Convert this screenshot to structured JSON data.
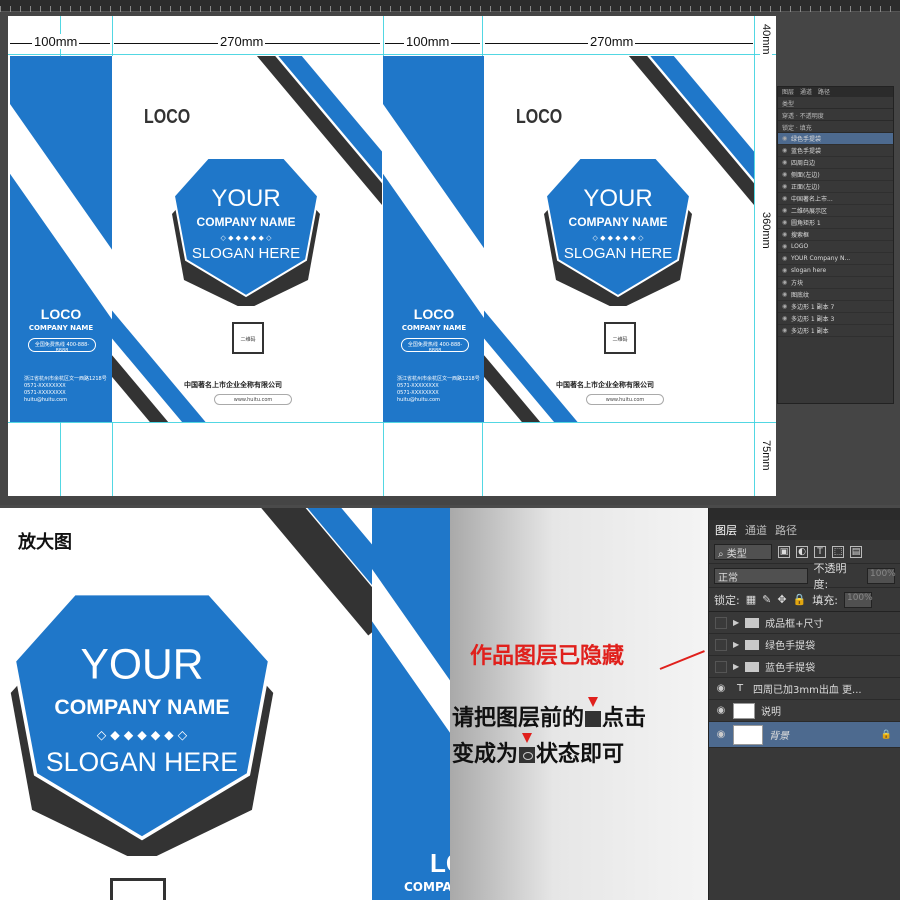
{
  "canvas": {
    "dimensions": [
      "100mm",
      "270mm",
      "100mm",
      "270mm"
    ],
    "side_dimensions": [
      "40mm",
      "360mm",
      "75mm"
    ]
  },
  "design": {
    "brand_logo": "LOCO",
    "badge": {
      "line1": "YOUR",
      "line2": "COMPANY NAME",
      "line3": "SLOGAN HERE"
    },
    "qr_label": "二维码",
    "company_full": "中国著名上市企业全称有限公司",
    "website": "www.huitu.com",
    "side_logo": "LOCO",
    "side_company": "COMPANY NAME",
    "side_hotline_label": "全国免费热线",
    "side_hotline": "400-888-8888",
    "side_address": "浙江省杭州市余杭区文一西路1218号",
    "side_phone1": "0571-XXXXXXXX",
    "side_phone2": "0571-XXXXXXXX",
    "side_email": "huitu@huitu.com"
  },
  "small_panel": {
    "tabs": [
      "图层",
      "通道",
      "路径"
    ],
    "kind": "类型",
    "blend": "穿透",
    "opacity_label": "不透明度",
    "lock_label": "锁定",
    "fill_label": "填充",
    "layers": [
      "绿色手提袋",
      "蓝色手提袋",
      "四周白边",
      "侧面(左边)",
      "正面(左边)",
      "中国著名上市...",
      "二维码展示区",
      "圆角矩形 1",
      "搜索框",
      "LOGO",
      "YOUR Company N...",
      "slogan here",
      "方块",
      "图底纹",
      "多边形 1 副本 7",
      "多边形 1 副本 3",
      "多边形 1 副本"
    ]
  },
  "zoom": {
    "label": "放大图",
    "badge": {
      "line1": "YOUR",
      "line2": "COMPANY NAME",
      "line3": "SLOGAN HERE"
    },
    "logo": "LOCO",
    "company": "COMPA"
  },
  "note": {
    "hidden_msg": "作品图层已隐藏",
    "inst1_a": "请把图层前的",
    "inst1_b": "点击",
    "inst2_a": "变成为",
    "inst2_b": "状态即可"
  },
  "layers_panel": {
    "tabs": [
      "图层",
      "通道",
      "路径"
    ],
    "kind": "类型",
    "blend": "正常",
    "opacity_label": "不透明度:",
    "opacity": "100%",
    "lock_label": "锁定:",
    "fill_label": "填充:",
    "fill": "100%",
    "layers": [
      {
        "name": "成品框+尺寸",
        "type": "folder",
        "visible": false
      },
      {
        "name": "绿色手提袋",
        "type": "folder",
        "visible": false
      },
      {
        "name": "蓝色手提袋",
        "type": "folder",
        "visible": false
      },
      {
        "name": "四周已加3mm出血 更...",
        "type": "text",
        "visible": true
      },
      {
        "name": "说明",
        "type": "image",
        "visible": true
      },
      {
        "name": "背景",
        "type": "background",
        "visible": true
      }
    ]
  },
  "colors": {
    "brand_blue": "#1f77c9",
    "dark_stripe": "#333333",
    "alert_red": "#e0201c",
    "guide": "#3fd3e0"
  }
}
